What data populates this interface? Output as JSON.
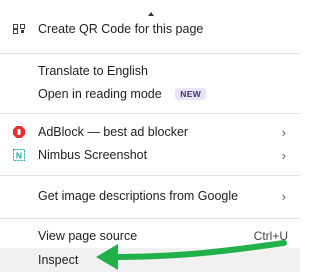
{
  "menu": {
    "items": {
      "qr": {
        "label": "Create QR Code for this page",
        "icon": "qr-code-icon"
      },
      "translate": {
        "label": "Translate to English"
      },
      "reading": {
        "label": "Open in reading mode",
        "badge": "NEW"
      },
      "adblock": {
        "label": "AdBlock — best ad blocker",
        "icon": "adblock-icon"
      },
      "nimbus": {
        "label": "Nimbus Screenshot",
        "icon": "nimbus-icon",
        "icon_letter": "N"
      },
      "imagedesc": {
        "label": "Get image descriptions from Google"
      },
      "viewsource": {
        "label": "View page source",
        "shortcut": "Ctrl+U"
      },
      "inspect": {
        "label": "Inspect"
      }
    },
    "submenu_indicator": "›"
  },
  "colors": {
    "annotation_arrow": "#22b04b",
    "badge_bg": "#e8e5f6",
    "adblock_red": "#e52f2f",
    "nimbus_teal": "#1aa9a4"
  }
}
